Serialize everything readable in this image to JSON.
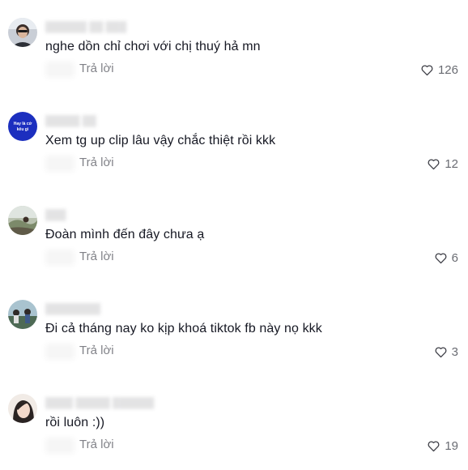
{
  "comments": [
    {
      "text": "nghe dồn chỉ chơi với chị thuý hả mn",
      "reply_label": "Trả lời",
      "likes": "126"
    },
    {
      "text": "Xem tg up clip lâu vậy chắc thiệt rồi kkk",
      "reply_label": "Trả lời",
      "likes": "12",
      "avatar_text_1": "Hay là cứ",
      "avatar_text_2": "kêu gì"
    },
    {
      "text": "Đoàn mình đến đây chưa ạ",
      "reply_label": "Trả lời",
      "likes": "6"
    },
    {
      "text": "Đi cả tháng nay ko kịp khoá tiktok fb này nọ kkk",
      "reply_label": "Trả lời",
      "likes": "3"
    },
    {
      "text": "rồi luôn :))",
      "reply_label": "Trả lời",
      "likes": "19"
    }
  ],
  "colors": {
    "text_primary": "#161823",
    "text_secondary": "#8a8b91",
    "avatar_blue": "#1c2fbf"
  },
  "icons": {
    "like": "heart-outline-icon"
  }
}
